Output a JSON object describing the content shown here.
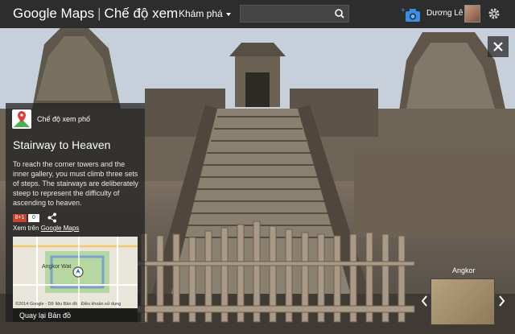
{
  "header": {
    "app_name": "Google Maps",
    "view_mode": "Chế độ xem",
    "explore_label": "Khám phá",
    "search_placeholder": "",
    "user_name": "Dương Lê"
  },
  "panel": {
    "mode_label": "Chế độ xem phố",
    "title": "Stairway to Heaven",
    "description": "To reach the corner towers and the inner gallery, you must climb three sets of steps. The stairways are deliberately steep to represent the difficulty of ascending to heaven.",
    "gplus_label": "8+1",
    "gplus_count": "0",
    "view_on_prefix": "Xem trên",
    "view_on_link": "Google Maps",
    "map_label": "Angkor Wat",
    "map_attribution": "©2014 Google - Dữ liệu Bản đồ",
    "map_terms": "Điều khoản sử dụng",
    "back_to_map": "Quay lại Bản đồ"
  },
  "thumbnail": {
    "label": "Angkor"
  },
  "icons": [
    "search-icon",
    "add-photo-icon",
    "gear-icon",
    "close-icon",
    "share-icon",
    "chevron-left-icon",
    "chevron-right-icon"
  ]
}
